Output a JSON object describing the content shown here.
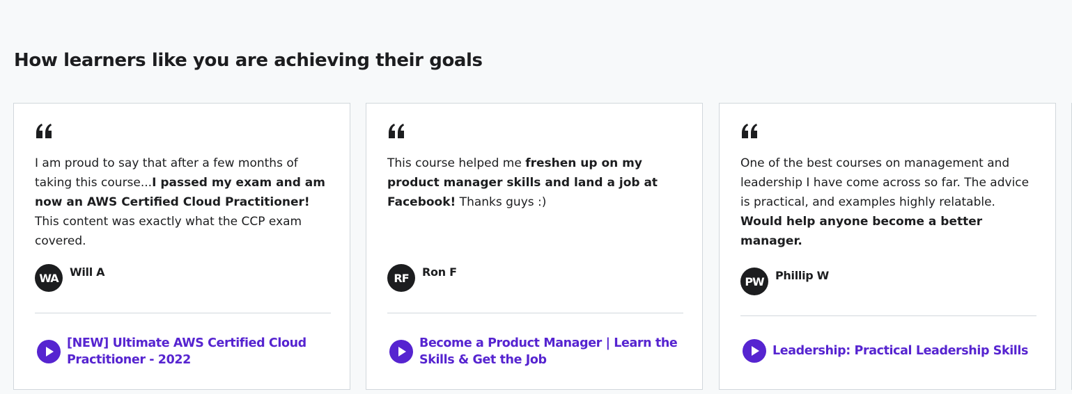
{
  "section": {
    "title": "How learners like you are achieving their goals"
  },
  "colors": {
    "background": "#f7f9fa",
    "card_background": "#ffffff",
    "card_border": "#d1d7dc",
    "accent_purple": "#5624d0",
    "avatar_background": "#1c1d1f",
    "text": "#1c1d1f"
  },
  "testimonials": [
    {
      "quote_icon": "quote-icon",
      "quote_parts": [
        {
          "text": "I am proud to say that after a few months of taking this course...",
          "bold": false
        },
        {
          "text": "I passed my exam and am now an AWS Certified Cloud Practitioner!",
          "bold": true
        },
        {
          "text": " This content was exactly what the CCP exam covered.",
          "bold": false
        }
      ],
      "author": {
        "initials": "WA",
        "name": "Will A"
      },
      "course": {
        "icon": "play-icon",
        "title": "[NEW] Ultimate AWS Certified Cloud Practitioner - 2022"
      }
    },
    {
      "quote_icon": "quote-icon",
      "quote_parts": [
        {
          "text": "This course helped me ",
          "bold": false
        },
        {
          "text": "freshen up on my product manager skills and land a job at Facebook!",
          "bold": true
        },
        {
          "text": " Thanks guys :)",
          "bold": false
        }
      ],
      "author": {
        "initials": "RF",
        "name": "Ron F"
      },
      "course": {
        "icon": "play-icon",
        "title": "Become a Product Manager | Learn the Skills & Get the Job"
      }
    },
    {
      "quote_icon": "quote-icon",
      "quote_parts": [
        {
          "text": "One of the best courses on management and leadership I have come across so far. The advice is practical, and examples highly relatable. ",
          "bold": false
        },
        {
          "text": "Would help anyone become a better manager.",
          "bold": true
        }
      ],
      "author": {
        "initials": "PW",
        "name": "Phillip W"
      },
      "course": {
        "icon": "play-icon",
        "title": "Leadership: Practical Leadership Skills"
      }
    }
  ]
}
